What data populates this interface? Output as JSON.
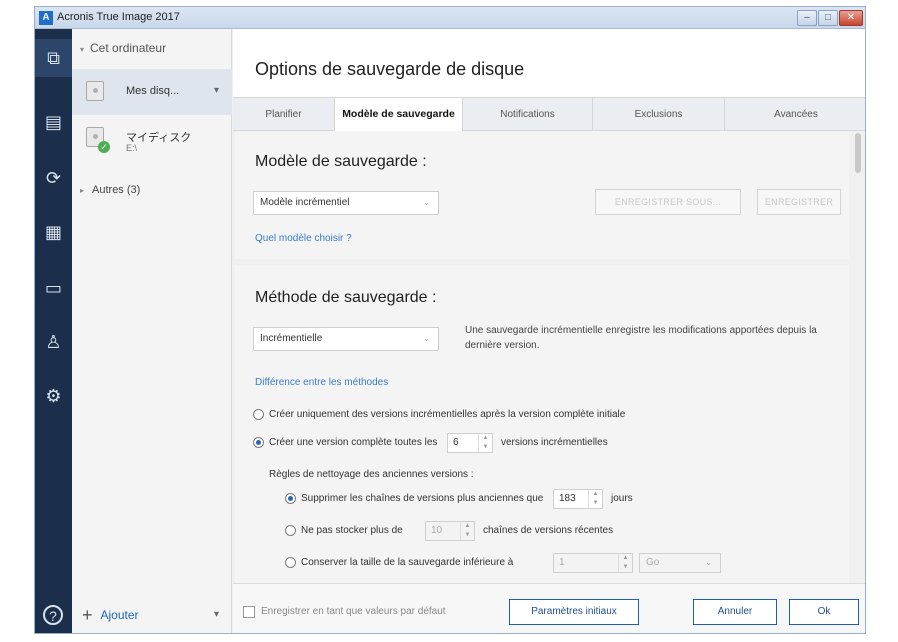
{
  "window": {
    "title": "Acronis True Image 2017"
  },
  "nav": {
    "tree_header": "Cet ordinateur",
    "items": [
      {
        "label": "Mes disq...",
        "selected": true
      },
      {
        "label": "マイディスク",
        "sublabel": "E:\\"
      }
    ],
    "others": "Autres (3)",
    "add_label": "Ajouter"
  },
  "main": {
    "title": "Options de sauvegarde de disque",
    "tabs": [
      {
        "label": "Planifier"
      },
      {
        "label": "Modèle de sauvegarde",
        "active": true
      },
      {
        "label": "Notifications"
      },
      {
        "label": "Exclusions"
      },
      {
        "label": "Avancées"
      }
    ]
  },
  "scheme": {
    "heading": "Modèle de sauvegarde :",
    "combo_value": "Modèle incrémentiel",
    "save_as_label": "ENREGISTRER SOUS...",
    "save_label": "ENREGISTRER",
    "help_link": "Quel modèle choisir ?"
  },
  "method": {
    "heading": "Méthode de sauvegarde :",
    "combo_value": "Incrémentielle",
    "description": "Une sauvegarde incrémentielle enregistre les modifications apportées depuis la dernière version.",
    "diff_link": "Différence entre les méthodes",
    "opt1_label": "Créer uniquement des versions incrémentielles après la version complète initiale",
    "opt2_prefix": "Créer une version complète toutes les",
    "opt2_value": "6",
    "opt2_suffix": "versions incrémentielles",
    "cleanup_title": "Règles de nettoyage des anciennes versions :",
    "rule1_prefix": "Supprimer les chaînes de versions plus anciennes que",
    "rule1_value": "183",
    "rule1_suffix": "jours",
    "rule2_prefix": "Ne pas stocker plus de",
    "rule2_value": "10",
    "rule2_suffix": "chaînes de versions récentes",
    "rule3_prefix": "Conserver la taille de la sauvegarde inférieure à",
    "rule3_value": "1",
    "rule3_unit": "Go"
  },
  "footer": {
    "default_checkbox_label": "Enregistrer en tant que valeurs par défaut",
    "reset_label": "Paramètres initiaux",
    "cancel_label": "Annuler",
    "ok_label": "Ok"
  },
  "icons": {
    "win_min": "–",
    "win_max": "□",
    "win_close": "✕",
    "dropdown": "⌄",
    "tri_down": "▾",
    "tri_right": "▸",
    "plus": "+",
    "spin_up": "▲",
    "spin_down": "▼",
    "check": "✓",
    "app": "A",
    "rail_backup": "⧉",
    "rail_archive": "▤",
    "rail_sync": "⟳",
    "rail_tools": "▦",
    "rail_devices": "▭",
    "rail_account": "♙",
    "rail_settings": "⚙",
    "rail_help": "?"
  },
  "colors": {
    "rail_bg": "#1b2e4b",
    "accent": "#1f5fb3",
    "link": "#3a7cc9"
  }
}
